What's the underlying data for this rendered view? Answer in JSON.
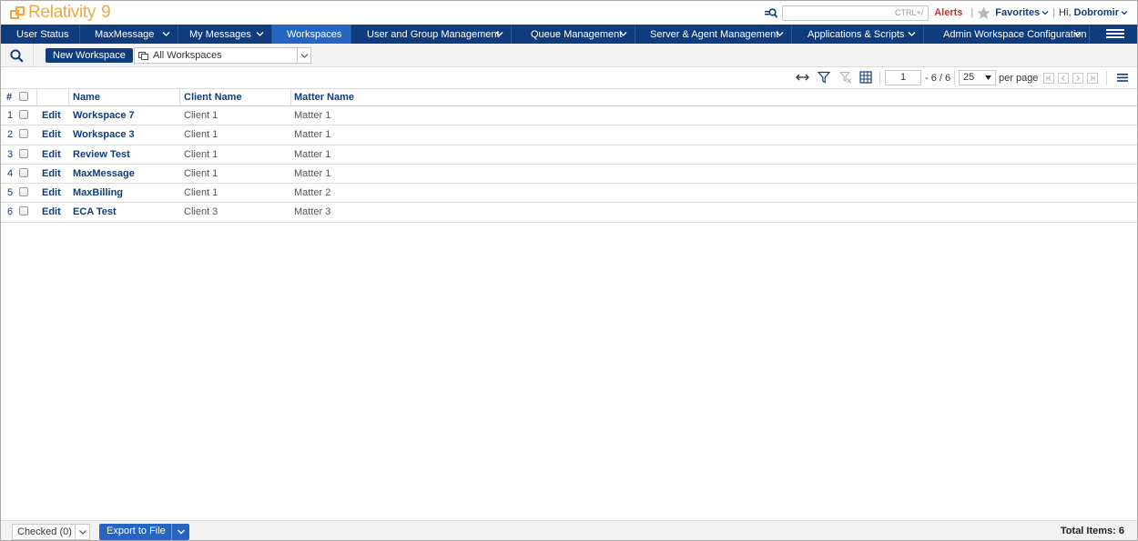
{
  "header": {
    "logo_text": "Relativity",
    "logo_version": "9",
    "search_hint": "CTRL+/",
    "alerts_label": "Alerts",
    "separator": "|",
    "favorites_label": "Favorites",
    "greeting": "Hi,",
    "username": "Dobromir",
    "icons": [
      "quick-nav-icon",
      "star-icon",
      "chevron-down-icon"
    ],
    "colors": {
      "brand": "#f0a93a",
      "nav_bg": "#0f3c7c",
      "nav_active": "#2466c2",
      "alert": "#c0392b"
    }
  },
  "nav": {
    "tabs": [
      {
        "label": "User Status",
        "dropdown": false,
        "active": false
      },
      {
        "label": "MaxMessage",
        "dropdown": true,
        "active": false
      },
      {
        "label": "My Messages",
        "dropdown": true,
        "active": false
      },
      {
        "label": "Workspaces",
        "dropdown": false,
        "active": true
      },
      {
        "label": "User and Group Management",
        "dropdown": true,
        "active": false
      },
      {
        "label": "Queue Management",
        "dropdown": true,
        "active": false
      },
      {
        "label": "Server & Agent Management",
        "dropdown": true,
        "active": false
      },
      {
        "label": "Applications & Scripts",
        "dropdown": true,
        "active": false
      },
      {
        "label": "Admin Workspace Configuration",
        "dropdown": true,
        "active": false
      }
    ]
  },
  "toolbar": {
    "new_button": "New Workspace",
    "view_selected": "All Workspaces"
  },
  "pager": {
    "page": "1",
    "range": "- 6 / 6",
    "per_page": "25",
    "per_page_label": "per page"
  },
  "grid": {
    "headers": {
      "num": "#",
      "name": "Name",
      "client": "Client Name",
      "matter": "Matter Name"
    },
    "edit_label": "Edit",
    "rows": [
      {
        "num": "1",
        "name": "Workspace 7",
        "client": "Client 1",
        "matter": "Matter 1"
      },
      {
        "num": "2",
        "name": "Workspace 3",
        "client": "Client 1",
        "matter": "Matter 1"
      },
      {
        "num": "3",
        "name": "Review Test",
        "client": "Client 1",
        "matter": "Matter 1"
      },
      {
        "num": "4",
        "name": "MaxMessage",
        "client": "Client 1",
        "matter": "Matter 1"
      },
      {
        "num": "5",
        "name": "MaxBilling",
        "client": "Client 1",
        "matter": "Matter 2"
      },
      {
        "num": "6",
        "name": "ECA Test",
        "client": "Client 3",
        "matter": "Matter 3"
      }
    ]
  },
  "footer": {
    "checked_label": "Checked (0)",
    "export_label": "Export to File",
    "total_label": "Total Items: 6"
  }
}
